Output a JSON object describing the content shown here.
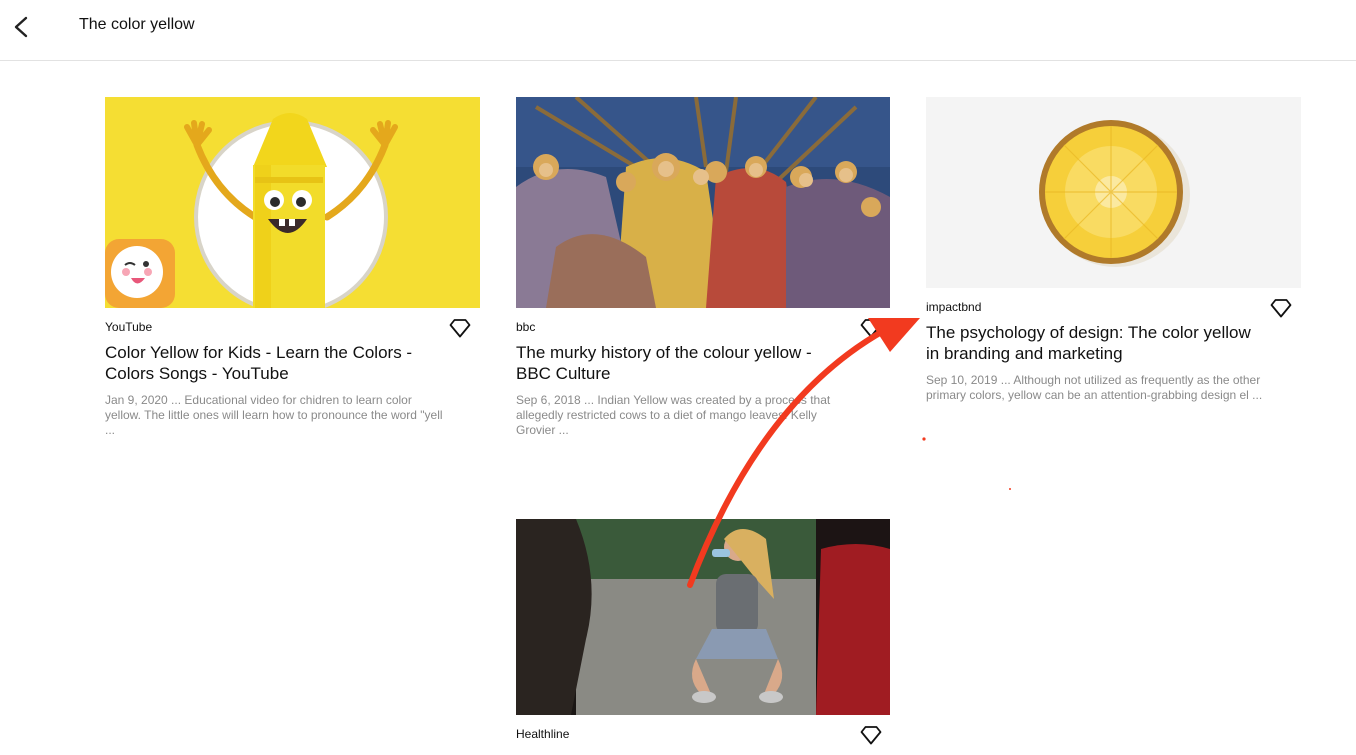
{
  "header": {
    "title": "The color yellow",
    "back_icon": "chevron-left-icon"
  },
  "results": [
    {
      "source": "YouTube",
      "title": "Color Yellow for Kids - Learn the Colors - Colors Songs - YouTube",
      "snippet": "Jan 9, 2020 ... Educational video for chidren to learn color yellow. The little ones will learn how to pronounce the word \"yell ...",
      "image": "yellow crayon cartoon character"
    },
    {
      "source": "bbc",
      "title": "The murky history of the colour yellow - BBC Culture",
      "snippet": "Sep 6, 2018 ... Indian Yellow was created by a process that allegedly restricted cows to a diet of mango leaves. Kelly Grovier ...",
      "image": "medieval fresco painting"
    },
    {
      "source": "impactbnd",
      "title": "The psychology of design: The color yellow in branding and marketing",
      "snippet": "Sep 10, 2019 ... Although not utilized as frequently as the other primary colors, yellow can be an attention-grabbing design el ...",
      "image": "pineapple slice"
    },
    {
      "source": "Healthline",
      "title": "",
      "snippet": "",
      "image": "woman drinking water on court"
    }
  ],
  "colors": {
    "annotation_arrow": "#f23a1f",
    "snippet_text": "#8a8a8a",
    "crayon_yellow": "#f2dc2a"
  }
}
